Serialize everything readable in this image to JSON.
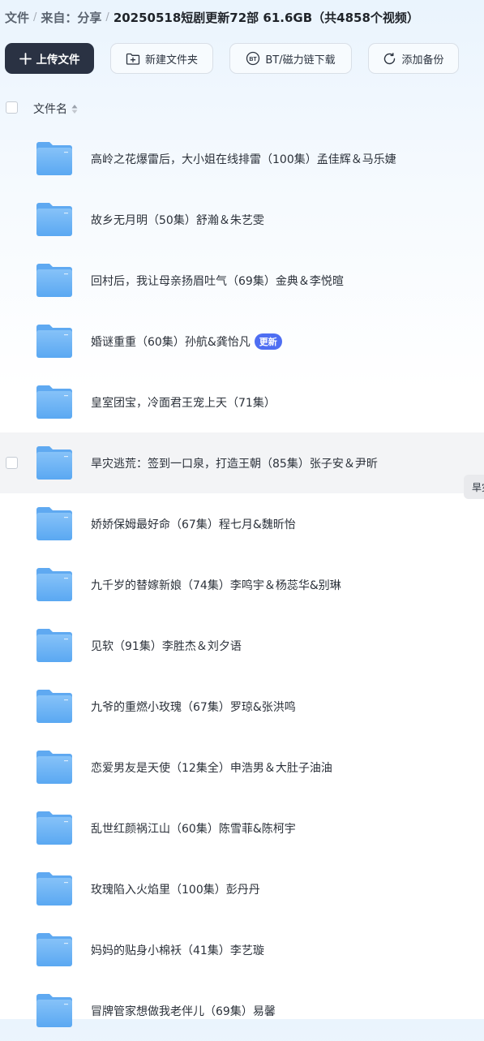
{
  "breadcrumb": {
    "root": "文件",
    "parent": "来自：分享",
    "current": "20250518短剧更新72部 61.6GB（共4858个视频）"
  },
  "toolbar": {
    "upload_label": "上传文件",
    "new_folder_label": "新建文件夹",
    "bt_label": "BT/磁力链下载",
    "backup_label": "添加备份"
  },
  "header": {
    "file_name_label": "文件名"
  },
  "files": [
    {
      "name": "高岭之花爆雷后，大小姐在线排雷（100集）孟佳辉＆马乐婕"
    },
    {
      "name": "故乡无月明（50集）舒瀚＆朱艺雯"
    },
    {
      "name": "回村后，我让母亲扬眉吐气（69集）金典＆李悦暄"
    },
    {
      "name": "婚谜重重（60集）孙航&龚怡凡",
      "badge": "更新"
    },
    {
      "name": "皇室团宝，冷面君王宠上天（71集）"
    },
    {
      "name": "旱灾逃荒：签到一口泉，打造王朝（85集）张子安＆尹昕"
    },
    {
      "name": "娇娇保姆最好命（67集）程七月&魏昕怡"
    },
    {
      "name": "九千岁的替嫁新娘（74集）李鸣宇＆杨蕊华&别琳"
    },
    {
      "name": "见软（91集）李胜杰＆刘夕语"
    },
    {
      "name": "九爷的重燃小玫瑰（67集）罗琼&张洪鸣"
    },
    {
      "name": "恋爱男友是天使（12集全）申浩男＆大肚子油油"
    },
    {
      "name": "乱世红颜祸江山（60集）陈雪菲&陈柯宇"
    },
    {
      "name": "玫瑰陷入火焰里（100集）彭丹丹"
    },
    {
      "name": "妈妈的贴身小棉袄（41集）李艺璇"
    },
    {
      "name": "冒牌管家想做我老伴儿（69集）易馨"
    }
  ],
  "tooltip": {
    "text": "旱灾"
  },
  "colors": {
    "primary_button": "#2a3243",
    "badge": "#4e6ef2",
    "folder": "#6eb4f5",
    "hover_row": "#f3f4f6"
  },
  "icons": {
    "upload": "plus-icon",
    "new_folder": "folder-plus-icon",
    "bt": "bt-icon",
    "backup": "sync-icon",
    "sort": "sort-icon",
    "folder": "folder-icon"
  }
}
